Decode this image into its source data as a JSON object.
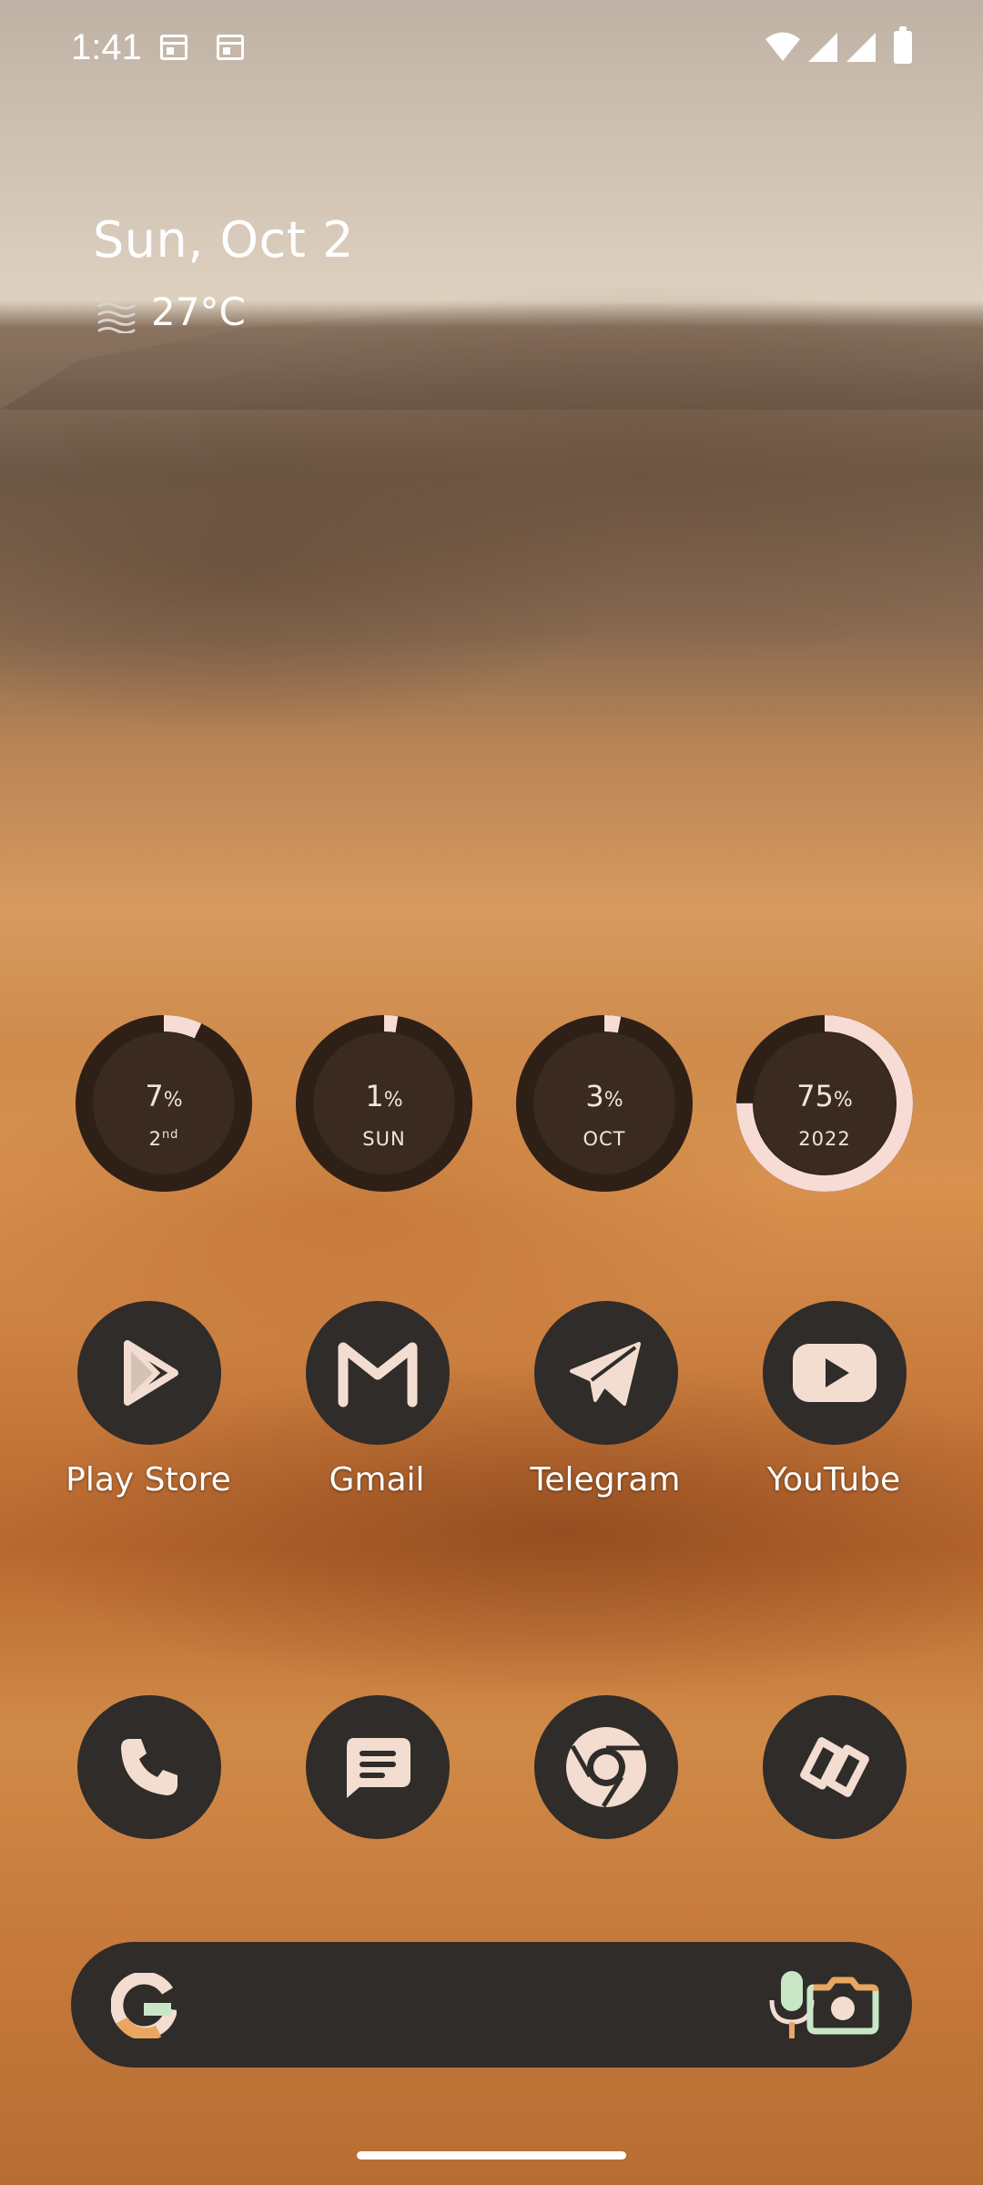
{
  "status_bar": {
    "time": "1:41",
    "notification_icons": [
      "calendar-icon",
      "calendar-icon"
    ],
    "system_icons": [
      "wifi-icon",
      "signal-icon",
      "signal-icon",
      "battery-icon"
    ]
  },
  "at_a_glance": {
    "date": "Sun, Oct 2",
    "weather_icon": "haze-icon",
    "temperature": "27°C"
  },
  "progress_widgets": [
    {
      "value": "7",
      "unit": "%",
      "label": "2",
      "label_suffix": "nd",
      "progress": 0.07
    },
    {
      "value": "1",
      "unit": "%",
      "label": "SUN",
      "label_suffix": "",
      "progress": 0.01
    },
    {
      "value": "3",
      "unit": "%",
      "label": "OCT",
      "label_suffix": "",
      "progress": 0.03
    },
    {
      "value": "75",
      "unit": "%",
      "label": "2022",
      "label_suffix": "",
      "progress": 0.75
    }
  ],
  "apps": [
    {
      "label": "Play Store",
      "icon": "play-store-icon"
    },
    {
      "label": "Gmail",
      "icon": "gmail-icon"
    },
    {
      "label": "Telegram",
      "icon": "telegram-icon"
    },
    {
      "label": "YouTube",
      "icon": "youtube-icon"
    }
  ],
  "dock": [
    {
      "icon": "phone-icon"
    },
    {
      "icon": "messages-icon"
    },
    {
      "icon": "chrome-icon"
    },
    {
      "icon": "gemini-link-icon"
    }
  ],
  "search_bar": {
    "logo": "google-g-icon",
    "mic": "mic-icon",
    "lens": "lens-icon"
  },
  "colors": {
    "icon_bg": "#2f2c2a",
    "icon_fg": "#f2ddd0",
    "ring_track": "#2e2017",
    "ring_fill": "#f6dcd4",
    "ring_inner": "#3a2a20"
  }
}
